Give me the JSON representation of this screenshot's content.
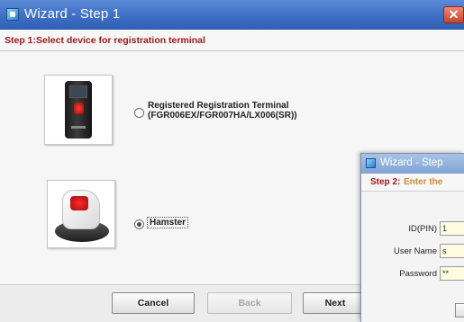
{
  "window1": {
    "title": "Wizard - Step 1",
    "close_symbol": "✕",
    "step_header": "Step 1:Select device for registration terminal",
    "options": [
      {
        "label_line1": "Registered Registration Terminal",
        "label_line2": "(FGR006EX/FGR007HA/LX006(SR))",
        "selected": false,
        "icon": "terminal-device-icon"
      },
      {
        "label": "Hamster",
        "selected": true,
        "icon": "hamster-device-icon"
      }
    ],
    "buttons": {
      "cancel": "Cancel",
      "back": "Back",
      "next": "Next"
    },
    "colors": {
      "title_bar": "#3d6fc4",
      "step_header_text": "#a01818"
    }
  },
  "window2": {
    "title": "Wizard - Step",
    "step_label": "Step 2:",
    "step_text": "Enter the",
    "fields": {
      "id_label": "ID(PIN)",
      "id_value": "1",
      "user_label": "User Name",
      "user_value": "s",
      "password_label": "Password",
      "password_value": "**"
    },
    "colors": {
      "input_bg": "#fffbe0",
      "step_text": "#d08a3a"
    }
  }
}
